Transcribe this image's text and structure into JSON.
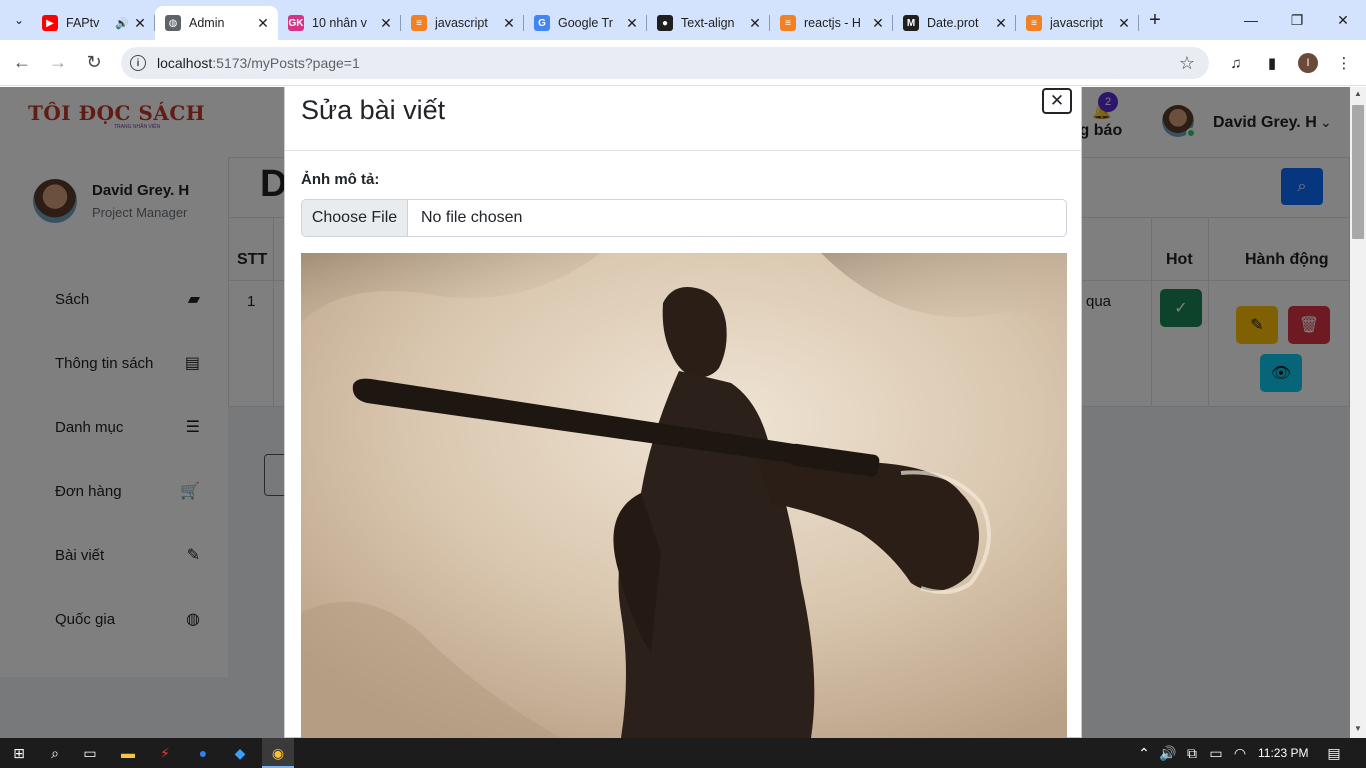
{
  "browser": {
    "tabs": [
      {
        "title": "FAPtv",
        "favicon": "youtube-icon",
        "color": "#ff0000",
        "audio": true
      },
      {
        "title": "Admin",
        "favicon": "globe-icon",
        "color": "#5f6368",
        "active": true
      },
      {
        "title": "10 nhân v",
        "favicon": "gk-icon",
        "color": "#d63384"
      },
      {
        "title": "javascript",
        "favicon": "stackoverflow-icon",
        "color": "#f48024"
      },
      {
        "title": "Google Tr",
        "favicon": "google-translate-icon",
        "color": "#4285f4"
      },
      {
        "title": "Text-align",
        "favicon": "github-icon",
        "color": "#1f1f1f"
      },
      {
        "title": "reactjs - H",
        "favicon": "stackoverflow-icon",
        "color": "#f48024"
      },
      {
        "title": "Date.prot",
        "favicon": "mdn-icon",
        "color": "#1f1f1f"
      },
      {
        "title": "javascript",
        "favicon": "stackoverflow-icon",
        "color": "#f48024"
      }
    ],
    "url_host": "localhost",
    "url_path": ":5173/myPosts?page=1",
    "profile_initial": "I"
  },
  "app": {
    "logo": "TÔI ĐỌC SÁCH",
    "logo_sub": "TRANG NHÂN VIÊN",
    "notification_count": "2",
    "notification_label": "ông báo",
    "user_name": "David Grey. H",
    "user_role": "Project Manager",
    "sidebar": [
      {
        "label": "Sách",
        "icon": "book-icon"
      },
      {
        "label": "Thông tin sách",
        "icon": "open-book-icon"
      },
      {
        "label": "Danh mục",
        "icon": "list-icon"
      },
      {
        "label": "Đơn hàng",
        "icon": "cart-icon"
      },
      {
        "label": "Bài viết",
        "icon": "pencil-icon"
      },
      {
        "label": "Quốc gia",
        "icon": "globe-icon"
      }
    ],
    "heading_partial": "D",
    "table": {
      "headers": {
        "stt": "STT",
        "hot": "Hot",
        "actions": "Hành động"
      },
      "row": {
        "stt": "1",
        "desc_partial": "qua"
      }
    }
  },
  "modal": {
    "title": "Sửa bài viết",
    "field_label": "Ảnh mô tả:",
    "file_button": "Choose File",
    "file_status": "No file chosen"
  },
  "taskbar": {
    "time": "11:23 PM"
  }
}
